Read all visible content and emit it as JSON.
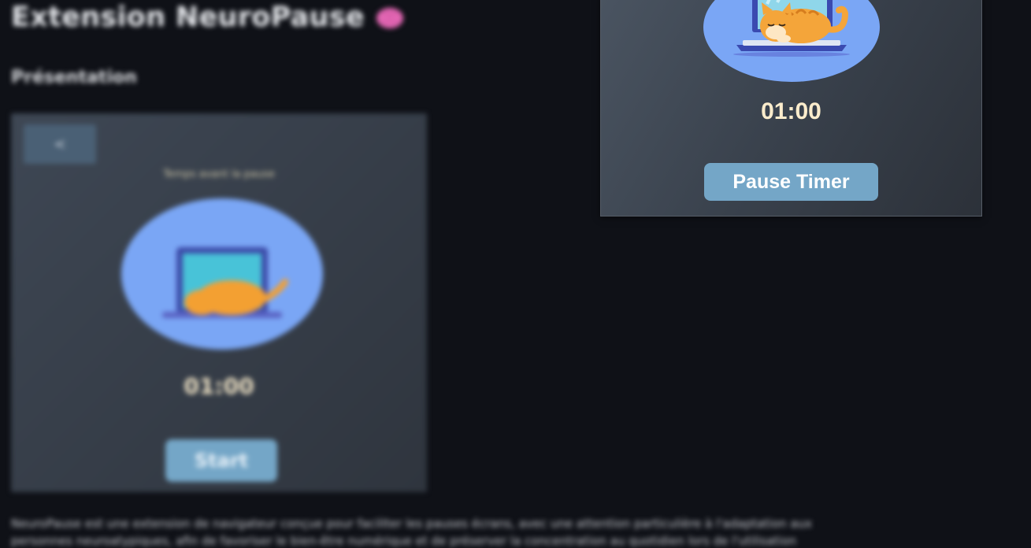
{
  "page": {
    "title": "Extension NeuroPause",
    "section_heading": "Présentation",
    "description_lines": [
      "NeuroPause est une extension de navigateur conçue pour faciliter les pauses écrans, avec une attention particulière à l'adaptation aux",
      "personnes neuroatypiques, afin de favoriser le bien-être numérique et de préserver la concentration au quotidien lors de l'utilisation"
    ]
  },
  "demo": {
    "back_label": "<",
    "caption": "Temps avant la pause",
    "time": "01:00",
    "start_label": "Start"
  },
  "popup": {
    "time": "01:00",
    "pause_label": "Pause Timer"
  },
  "icons": {
    "brain": "brain-icon",
    "cat": "sleeping-cat-laptop-icon"
  },
  "colors": {
    "background": "#0f1117",
    "button": "#74a6c7",
    "oval": "#7aa6f5",
    "timer_text": "#fbeccc"
  }
}
